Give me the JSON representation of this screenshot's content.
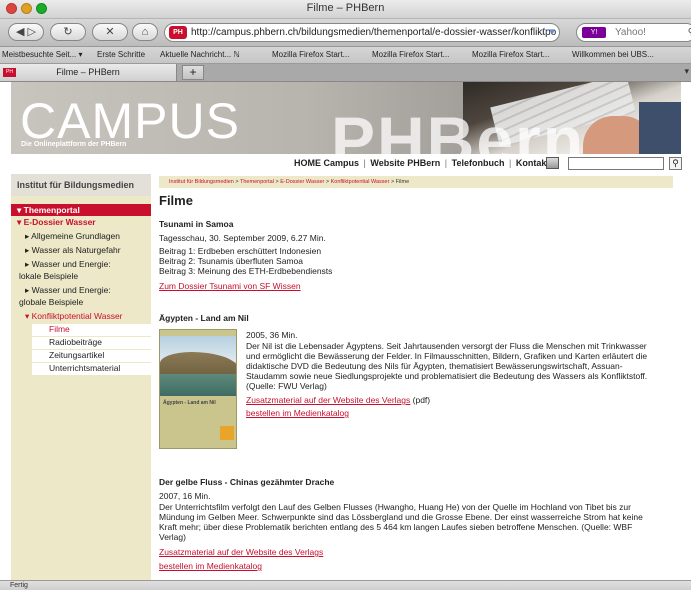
{
  "window": {
    "title": "Filme – PHBern"
  },
  "toolbar": {
    "url": "http://campus.phbern.ch/bildungsmedien/themenportal/e-dossier-wasser/konfliktpo",
    "search_placeholder": "Yahoo!",
    "favicon_label": "PH",
    "search_engine_label": "Y!"
  },
  "bookmarks": [
    "Meistbesuchte Seit... ▾",
    "Erste Schritte",
    "Aktuelle Nachricht... ℕ",
    "Mozilla Firefox Start...",
    "Mozilla Firefox Start...",
    "Mozilla Firefox Start...",
    "Willkommen bei UBS..."
  ],
  "tab": {
    "label": "Filme – PHBern",
    "favicon_label": "PH",
    "new_tab": "+"
  },
  "banner": {
    "brand": "CAMPUS",
    "tagline": "Die Onlineplattform der PHBern",
    "watermark": "PHBern"
  },
  "topnav": {
    "home": "HOME Campus",
    "website": "Website PHBern",
    "phonebook": "Telefonbuch",
    "contact": "Kontakt",
    "sep": "|"
  },
  "sidebar": {
    "heading": "Institut für Bildungsmedien",
    "active": "Themenportal",
    "items": {
      "dossier": "E-Dossier Wasser",
      "grundlagen": "Allgemeine Grundlagen",
      "naturgefahr": "Wasser als Naturgefahr",
      "energie_lokal_1": "Wasser und Energie:",
      "energie_lokal_2": "lokale Beispiele",
      "energie_global_1": "Wasser und Energie:",
      "energie_global_2": "globale Beispiele",
      "konflikt": "Konfliktpotential Wasser",
      "filme": "Filme",
      "radio": "Radiobeiträge",
      "zeitung": "Zeitungsartikel",
      "unterricht": "Unterrichtsmaterial"
    }
  },
  "breadcrumb": {
    "items": [
      "Institut für Bildungsmedien",
      "Themenportal",
      "E-Dossier Wasser",
      "Konfliktpotential Wasser"
    ],
    "current": "Filme",
    "sep": ">"
  },
  "content": {
    "title": "Filme",
    "sections": [
      {
        "heading": "Tsunami in Samoa",
        "meta": "Tagesschau, 30. September 2009, 6.27 Min.",
        "lines": [
          "Beitrag 1: Erdbeben erschüttert Indonesien",
          "Beitrag 2: Tsunamis überfluten Samoa",
          "Beitrag 3: Meinung des ETH-Erdbebendiensts"
        ],
        "link": "Zum Dossier Tsunami von SF Wissen"
      },
      {
        "heading": "Ägypten - Land am Nil",
        "meta": "2005, 36 Min.",
        "body": [
          "Der Nil ist die Lebensader Ägyptens. Seit Jahrtausenden versorgt der Fluss die Menschen mit Trinkwasser",
          "und ermöglicht die Bewässerung der Felder. In Filmausschnitten, Bildern, Grafiken und Karten erläutert die",
          "didaktische DVD die Bedeutung des Nils für Ägypten, thematisiert Bewässerungswirtschaft, Assuan-",
          "Staudamm sowie neue Siedlungsprojekte und problematisiert die Bedeutung des Wassers als Konfliktstoff.",
          "(Quelle: FWU Verlag)"
        ],
        "link1": "Zusatzmaterial auf der Website des Verlags",
        "link1_suffix": "(pdf)",
        "link2": "bestellen im Medienkatalog",
        "cover_title": "Ägypten - Land am Nil"
      },
      {
        "heading": "Der gelbe Fluss - Chinas gezähmter Drache",
        "meta": "2007, 16 Min.",
        "body": [
          "Der Unterrichtsfilm verfolgt den Lauf des Gelben Flusses (Hwangho, Huang He) von der Quelle im Hochland von Tibet bis zur",
          "Mündung im Gelben Meer. Schwerpunkte sind das Lössbergland und die Grosse Ebene. Der einst wasserreiche Strom hat keine",
          "Kraft mehr; über diese Problematik berichten entlang des 5 464 km langen Laufes sieben betroffene Menschen. (Quelle: WBF",
          "Verlag)"
        ],
        "link1": "Zusatzmaterial auf der Website des Verlags",
        "link2": "bestellen im Medienkatalog"
      }
    ]
  },
  "statusbar": {
    "text": "Fertig"
  }
}
